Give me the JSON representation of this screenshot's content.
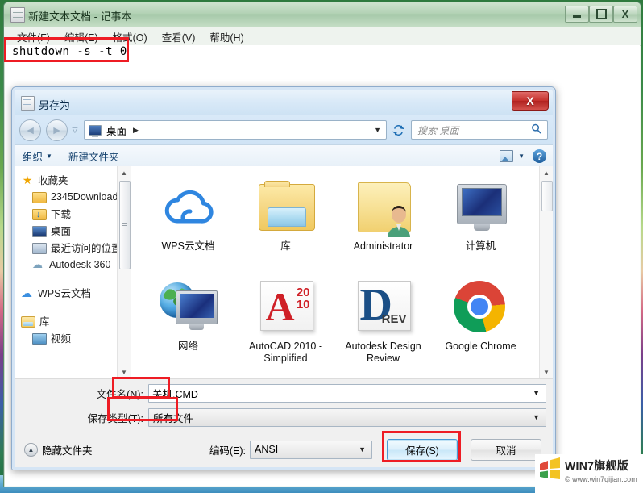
{
  "notepad": {
    "title": "新建文本文档 - 记事本",
    "icon": "notepad-icon",
    "menus": [
      "文件(F)",
      "编辑(E)",
      "格式(O)",
      "查看(V)",
      "帮助(H)"
    ],
    "content": "shutdown -s -t 0",
    "window_buttons": {
      "minimize": "minimize-icon",
      "maximize": "maximize-icon",
      "close": "X"
    }
  },
  "dialog": {
    "title": "另存为",
    "close_label": "X",
    "nav": {
      "back": "◄",
      "forward": "►",
      "history_caret": "▽",
      "address_value": "桌面",
      "address_separator": "▶",
      "address_caret": "▼",
      "refresh_icon": "refresh-icon",
      "search_placeholder": "搜索 桌面",
      "search_icon": "search-icon"
    },
    "toolbar": {
      "organize": "组织",
      "organize_caret": "▼",
      "new_folder": "新建文件夹",
      "view_caret": "▼",
      "help": "?"
    },
    "sidebar": [
      {
        "label": "收藏夹",
        "icon": "star-icon",
        "level": 0
      },
      {
        "label": "2345Download",
        "icon": "folder-icon",
        "level": 1
      },
      {
        "label": "下载",
        "icon": "folder-download-icon",
        "level": 1
      },
      {
        "label": "桌面",
        "icon": "desktop-icon",
        "level": 1
      },
      {
        "label": "最近访问的位置",
        "icon": "recent-places-icon",
        "level": 1
      },
      {
        "label": "Autodesk 360",
        "icon": "autodesk-cloud-icon",
        "level": 1
      },
      {
        "label": "WPS云文档",
        "icon": "wps-cloud-icon",
        "level": 0
      },
      {
        "label": "库",
        "icon": "library-icon",
        "level": 0
      },
      {
        "label": "视频",
        "icon": "video-icon",
        "level": 1
      }
    ],
    "files": [
      {
        "label": "WPS云文档",
        "icon": "wps-cloud-icon"
      },
      {
        "label": "库",
        "icon": "library-folder-icon"
      },
      {
        "label": "Administrator",
        "icon": "user-folder-icon"
      },
      {
        "label": "计算机",
        "icon": "computer-icon"
      },
      {
        "label": "网络",
        "icon": "network-icon"
      },
      {
        "label": "AutoCAD 2010 - Simplified",
        "icon": "autocad-icon",
        "badge": "20\n10"
      },
      {
        "label": "Autodesk Design Review",
        "icon": "design-review-icon",
        "badge": "REV"
      },
      {
        "label": "Google Chrome",
        "icon": "chrome-icon"
      }
    ],
    "form": {
      "filename_label": "文件名(N):",
      "filename_value": "关机.CMD",
      "filetype_label": "保存类型(T):",
      "filetype_value": "所有文件",
      "caret": "▼"
    },
    "footer": {
      "hide_folders": "隐藏文件夹",
      "hide_folders_caret": "▲",
      "encoding_label": "编码(E):",
      "encoding_value": "ANSI",
      "save_label": "保存(S)",
      "cancel_label": "取消"
    }
  },
  "watermark": {
    "title": "WIN7旗舰版",
    "url": "www.win7qijian.com",
    "copyright": "©"
  },
  "colors": {
    "annotation_red": "#ee1c24",
    "dialog_chrome": "#d7e8f7",
    "notepad_chrome": "#b3d2b5",
    "accent_blue": "#4a9ad4"
  }
}
